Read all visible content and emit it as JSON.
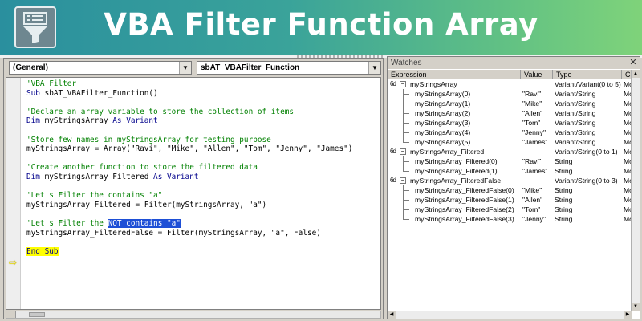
{
  "banner": {
    "title": "VBA Filter Function Array",
    "logo_icon": "filter-funnel-icon"
  },
  "code_window": {
    "object_dropdown": "(General)",
    "procedure_dropdown": "sbAT_VBAFilter_Function",
    "lines": [
      [
        {
          "t": "'VBA Filter",
          "c": "comment"
        }
      ],
      [
        {
          "t": "Sub ",
          "c": "kw"
        },
        {
          "t": "sbAT_VBAFilter_Function()",
          "c": "plain"
        }
      ],
      [],
      [
        {
          "t": "'Declare an array variable to store the collection of items",
          "c": "comment"
        }
      ],
      [
        {
          "t": "Dim ",
          "c": "kw"
        },
        {
          "t": "myStringsArray ",
          "c": "plain"
        },
        {
          "t": "As ",
          "c": "kw"
        },
        {
          "t": "Variant",
          "c": "kw"
        }
      ],
      [],
      [
        {
          "t": "'Store few names in myStringsArray for testing purpose",
          "c": "comment"
        }
      ],
      [
        {
          "t": "myStringsArray = Array(\"Ravi\", \"Mike\", \"Allen\", \"Tom\", \"Jenny\", \"James\")",
          "c": "plain"
        }
      ],
      [],
      [
        {
          "t": "'Create another function to store the filtered data",
          "c": "comment"
        }
      ],
      [
        {
          "t": "Dim ",
          "c": "kw"
        },
        {
          "t": "myStringsArray_Filtered ",
          "c": "plain"
        },
        {
          "t": "As ",
          "c": "kw"
        },
        {
          "t": "Variant",
          "c": "kw"
        }
      ],
      [],
      [
        {
          "t": "'Let's Filter the contains \"a\"",
          "c": "comment"
        }
      ],
      [
        {
          "t": "myStringsArray_Filtered = Filter(myStringsArray, \"a\")",
          "c": "plain"
        }
      ],
      [],
      [
        {
          "t": "'Let's Filter the ",
          "c": "comment"
        },
        {
          "t": "NOT contains \"a\"",
          "c": "sel"
        }
      ],
      [
        {
          "t": "myStringsArray_FilteredFalse = Filter(myStringsArray, \"a\", False)",
          "c": "plain"
        }
      ],
      [],
      [
        {
          "t": "End Sub",
          "c": "end"
        }
      ]
    ],
    "execution_line_index": 18
  },
  "watches": {
    "title": "Watches",
    "columns": [
      "Expression",
      "Value",
      "Type",
      "C"
    ],
    "rows": [
      {
        "level": 0,
        "expr": "myStringsArray",
        "value": "",
        "type": "Variant/Variant(0 to 5)",
        "ctx": "Mo",
        "toggle": "−"
      },
      {
        "level": 1,
        "expr": "myStringsArray(0)",
        "value": "\"Ravi\"",
        "type": "Variant/String",
        "ctx": "Mo"
      },
      {
        "level": 1,
        "expr": "myStringsArray(1)",
        "value": "\"Mike\"",
        "type": "Variant/String",
        "ctx": "Mo"
      },
      {
        "level": 1,
        "expr": "myStringsArray(2)",
        "value": "\"Allen\"",
        "type": "Variant/String",
        "ctx": "Mo"
      },
      {
        "level": 1,
        "expr": "myStringsArray(3)",
        "value": "\"Tom\"",
        "type": "Variant/String",
        "ctx": "Mo"
      },
      {
        "level": 1,
        "expr": "myStringsArray(4)",
        "value": "\"Jenny\"",
        "type": "Variant/String",
        "ctx": "Mo"
      },
      {
        "level": 1,
        "expr": "myStringsArray(5)",
        "value": "\"James\"",
        "type": "Variant/String",
        "ctx": "Mo"
      },
      {
        "level": 0,
        "expr": "myStringsArray_Filtered",
        "value": "",
        "type": "Variant/String(0 to 1)",
        "ctx": "Mo",
        "toggle": "−"
      },
      {
        "level": 1,
        "expr": "myStringsArray_Filtered(0)",
        "value": "\"Ravi\"",
        "type": "String",
        "ctx": "Mo"
      },
      {
        "level": 1,
        "expr": "myStringsArray_Filtered(1)",
        "value": "\"James\"",
        "type": "String",
        "ctx": "Mo"
      },
      {
        "level": 0,
        "expr": "myStringsArray_FilteredFalse",
        "value": "",
        "type": "Variant/String(0 to 3)",
        "ctx": "Mo",
        "toggle": "−"
      },
      {
        "level": 1,
        "expr": "myStringsArray_FilteredFalse(0)",
        "value": "\"Mike\"",
        "type": "String",
        "ctx": "Mo"
      },
      {
        "level": 1,
        "expr": "myStringsArray_FilteredFalse(1)",
        "value": "\"Allen\"",
        "type": "String",
        "ctx": "Mo"
      },
      {
        "level": 1,
        "expr": "myStringsArray_FilteredFalse(2)",
        "value": "\"Tom\"",
        "type": "String",
        "ctx": "Mo"
      },
      {
        "level": 1,
        "expr": "myStringsArray_FilteredFalse(3)",
        "value": "\"Jenny\"",
        "type": "String",
        "ctx": "Mo"
      }
    ],
    "glasses_glyph": "6d"
  },
  "colors": {
    "comment": "#008000",
    "keyword": "#00008b",
    "selection": "#1e4fd6",
    "current_line_highlight": "#ffff00"
  }
}
